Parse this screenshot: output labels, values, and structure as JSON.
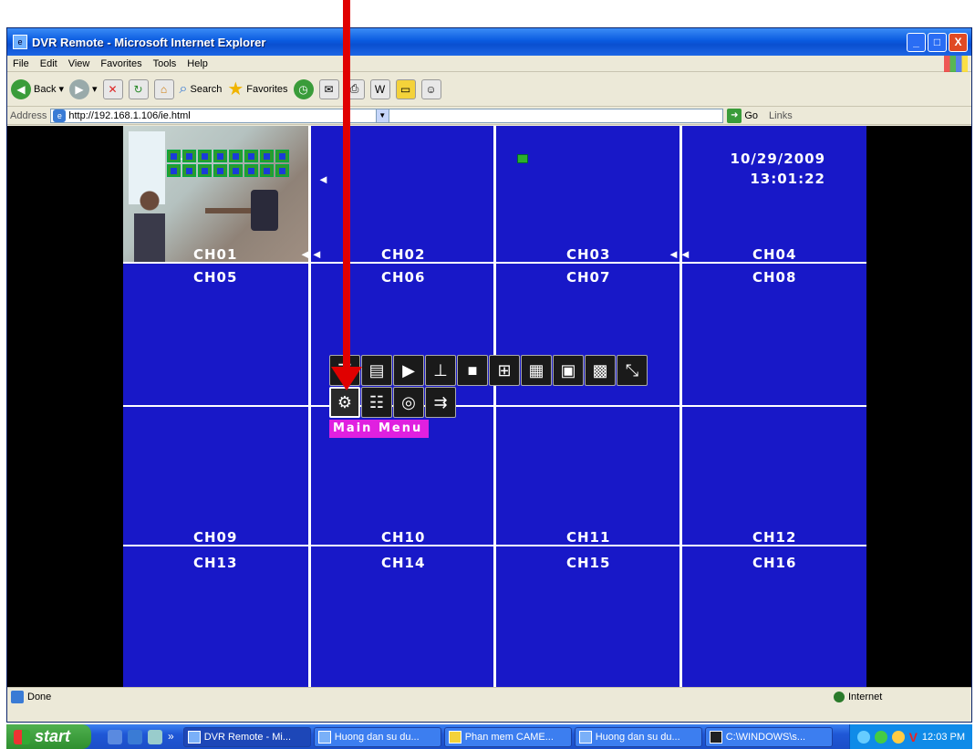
{
  "window": {
    "title": "DVR Remote - Microsoft Internet Explorer",
    "controls": {
      "minimize": "_",
      "maximize": "□",
      "close": "X"
    }
  },
  "menubar": [
    "File",
    "Edit",
    "View",
    "Favorites",
    "Tools",
    "Help"
  ],
  "toolbar": {
    "back": "Back",
    "search": "Search",
    "favorites": "Favorites"
  },
  "addressbar": {
    "label": "Address",
    "url": "http://192.168.1.106/ie.html",
    "go": "Go",
    "links": "Links"
  },
  "dvr": {
    "camera_number": "1",
    "datetime": {
      "date": "10/29/2009",
      "time": "13:01:22"
    },
    "channels": [
      "CH01",
      "CH02",
      "CH03",
      "CH04",
      "CH05",
      "CH06",
      "CH07",
      "CH08",
      "CH09",
      "CH10",
      "CH11",
      "CH12",
      "CH13",
      "CH14",
      "CH15",
      "CH16"
    ],
    "main_menu_tooltip": "Main Menu"
  },
  "statusbar": {
    "status": "Done",
    "zone": "Internet"
  },
  "taskbar": {
    "start": "start",
    "tasks": [
      "DVR Remote - Mi...",
      "Huong dan su du...",
      "Phan mem CAME...",
      "Huong dan su du...",
      "C:\\WINDOWS\\s..."
    ],
    "clock": "12:03 PM"
  },
  "colors": {
    "dvr_background": "#1818c8",
    "tooltip": "#e020e0",
    "annotation_arrow": "#e00000"
  }
}
